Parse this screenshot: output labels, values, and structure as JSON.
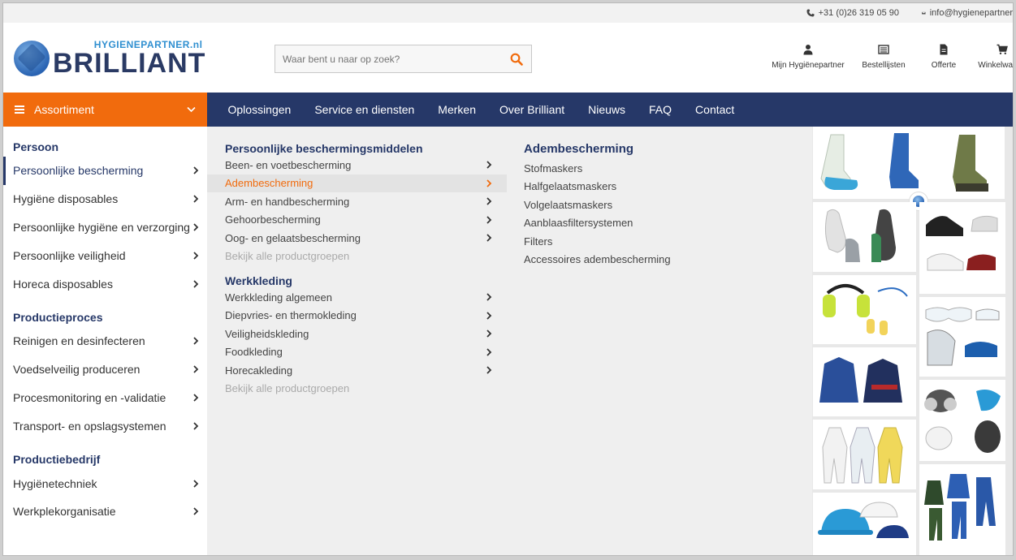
{
  "topbar": {
    "phone": "+31 (0)26 319 05 90",
    "email": "info@hygienepartner"
  },
  "logo": {
    "small": "HYGIENEPARTNER.nl",
    "big": "BRILLIANT"
  },
  "search": {
    "placeholder": "Waar bent u naar op zoek?"
  },
  "header_links": [
    {
      "label": "Mijn Hygiënepartner",
      "icon": "user-icon"
    },
    {
      "label": "Bestellijsten",
      "icon": "list-icon"
    },
    {
      "label": "Offerte",
      "icon": "document-icon"
    },
    {
      "label": "Winkelwagen",
      "icon": "cart-icon"
    }
  ],
  "nav": {
    "assortment": "Assortiment",
    "items": [
      "Oplossingen",
      "Service en diensten",
      "Merken",
      "Over Brilliant",
      "Nieuws",
      "FAQ",
      "Contact"
    ]
  },
  "col1": {
    "groups": [
      {
        "title": "Persoon",
        "items": [
          "Persoonlijke bescherming",
          "Hygiëne disposables",
          "Persoonlijke hygiëne en verzorging",
          "Persoonlijke veiligheid",
          "Horeca disposables"
        ]
      },
      {
        "title": "Productieproces",
        "items": [
          "Reinigen en desinfecteren",
          "Voedselveilig produceren",
          "Procesmonitoring en -validatie",
          "Transport- en opslagsystemen"
        ]
      },
      {
        "title": "Productiebedrijf",
        "items": [
          "Hygiënetechniek",
          "Werkplekorganisatie"
        ]
      }
    ]
  },
  "col2": {
    "groups": [
      {
        "title": "Persoonlijke beschermingsmiddelen",
        "items": [
          "Been- en voetbescherming",
          "Adembescherming",
          "Arm- en handbescherming",
          "Gehoorbescherming",
          "Oog- en gelaatsbescherming"
        ],
        "view_all": "Bekijk alle productgroepen"
      },
      {
        "title": "Werkkleding",
        "items": [
          "Werkkleding algemeen",
          "Diepvries- en thermokleding",
          "Veiligheidskleding",
          "Foodkleding",
          "Horecakleding"
        ],
        "view_all": "Bekijk alle productgroepen"
      }
    ]
  },
  "col3": {
    "title": "Adembescherming",
    "items": [
      "Stofmaskers",
      "Halfgelaatsmaskers",
      "Volgelaatsmaskers",
      "Aanblaasfiltersystemen",
      "Filters",
      "Accessoires adembescherming"
    ]
  },
  "colors": {
    "navy": "#263868",
    "orange": "#f16b0d"
  }
}
